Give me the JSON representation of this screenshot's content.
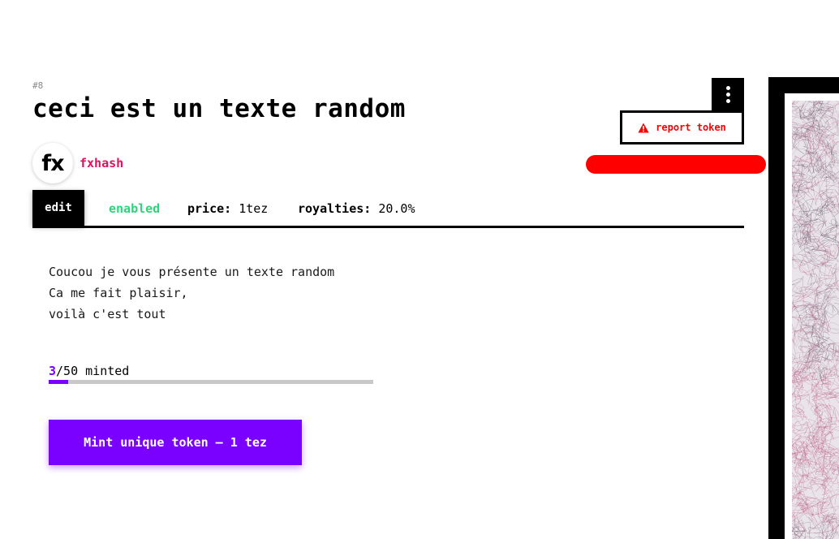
{
  "token": {
    "number": "#8",
    "title": "ceci est un texte random",
    "author": {
      "avatar_text": "fx",
      "name": "fxhash"
    },
    "menu_icon": "vertical-dots-icon",
    "report_label": "report token",
    "report_icon": "warning-triangle-icon",
    "edit_label": "edit",
    "status": "enabled",
    "price_key": "price:",
    "price_value": "1tez",
    "royalties_key": "royalties:",
    "royalties_value": "20.0%",
    "description_lines": [
      "Coucou je vous présente un texte random",
      "Ca me fait plaisir,",
      "voilà c'est tout"
    ],
    "minted": {
      "count": "3",
      "rest": "/50 minted",
      "progress": 0.06
    },
    "mint_button": "Mint unique token — 1 tez"
  },
  "colors": {
    "accent": "#7a00ff",
    "author": "#e0125e",
    "enabled": "#2bd67b",
    "report": "#ff0000"
  }
}
